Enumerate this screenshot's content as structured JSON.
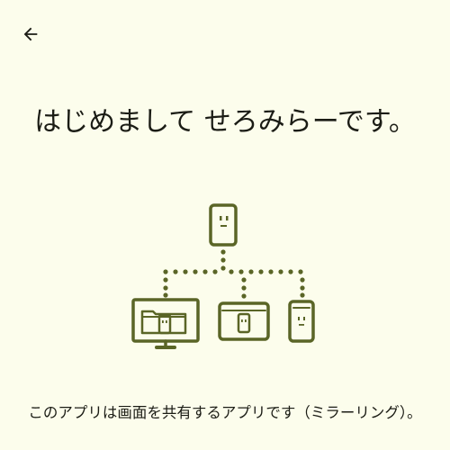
{
  "colors": {
    "background": "#fcfdec",
    "text": "#1b1c15",
    "illustration": "#5a6526"
  },
  "header": {
    "back_icon": "arrow-back-icon"
  },
  "main": {
    "title": "はじめまして せろみらーです。",
    "illustration_icon": "screen-mirroring-devices-illustration",
    "description": "このアプリは画面を共有するアプリです（ミラーリング）。"
  }
}
